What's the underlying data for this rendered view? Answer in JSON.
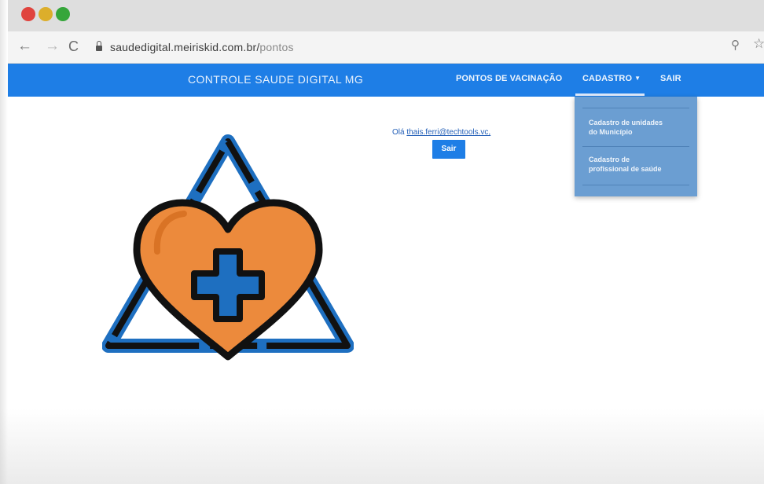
{
  "browser": {
    "url_host": "saudedigital.meiriskid.com.br/",
    "url_path": "pontos",
    "back_icon": "←",
    "forward_icon": "→",
    "reload_icon": "C",
    "zoom_icon": "⚲",
    "star_icon": "☆"
  },
  "navbar": {
    "brand": "CONTROLE SAUDE DIGITAL MG",
    "items": [
      {
        "label": "PONTOS DE VACINAÇÃO"
      },
      {
        "label": "CADASTRO"
      },
      {
        "label": "SAIR"
      }
    ],
    "caret": "▼"
  },
  "dropdown": {
    "items": [
      {
        "line1": "Cadastro de unidades",
        "line2": "do Município"
      },
      {
        "line1": "Cadastro de",
        "line2": "profissional de saúde"
      }
    ]
  },
  "content": {
    "greeting_prefix": "Olá",
    "user_email": "thais.ferri@techtools.vc,",
    "logout_label": "Sair"
  },
  "colors": {
    "navbar": "#1e7ee6",
    "dropdown": "#6b9ed2",
    "heart": "#ec8a3c",
    "triangle": "#1e6fc0",
    "cross": "#1e6fc0"
  }
}
